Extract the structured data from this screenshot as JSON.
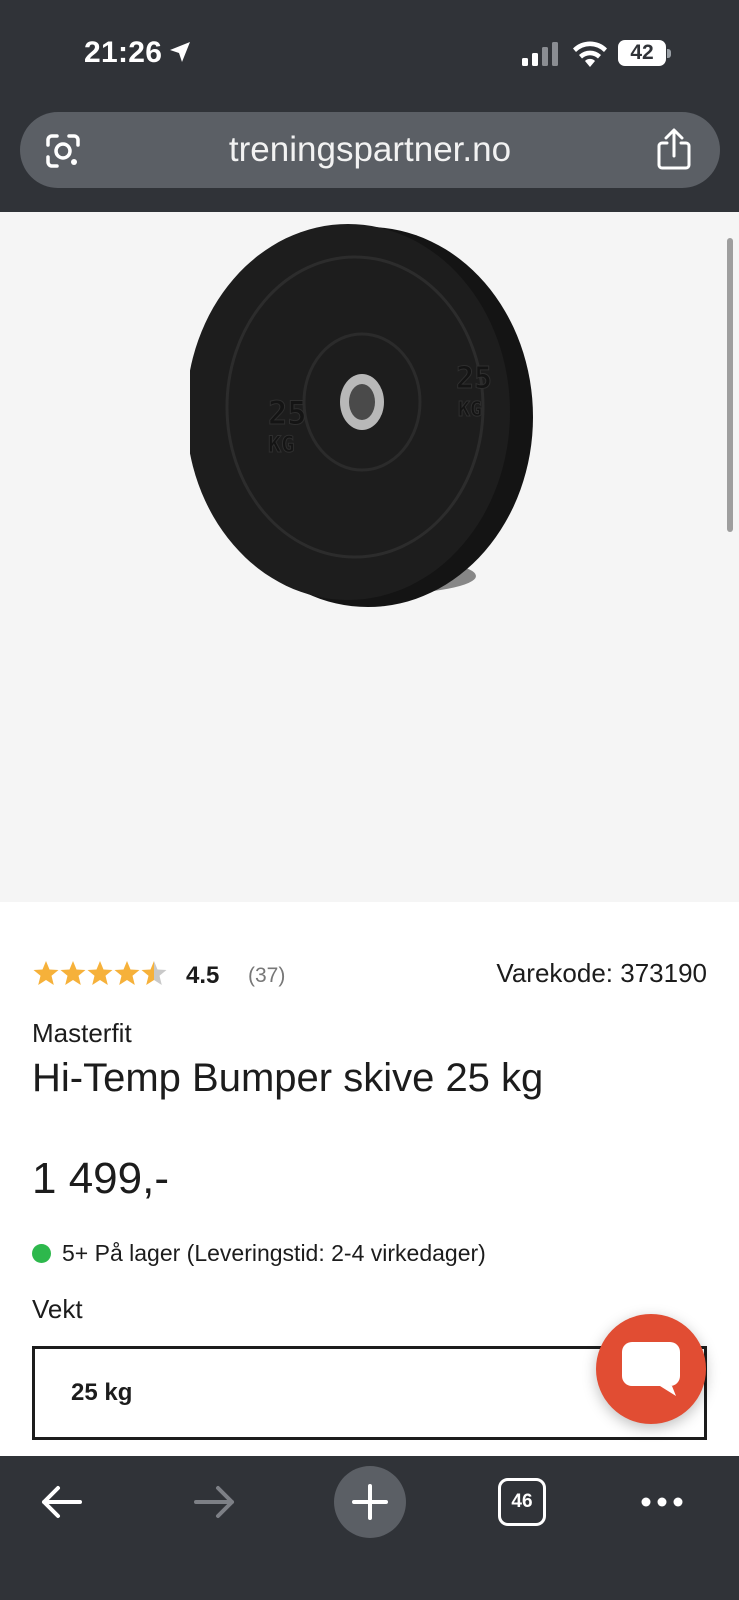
{
  "status_bar": {
    "time": "21:26",
    "battery": "42"
  },
  "browser": {
    "url": "treningspartner.no",
    "tab_count": "46"
  },
  "product": {
    "rating": {
      "value": "4.5",
      "count": "(37)",
      "stars": 4.5
    },
    "sku": "Varekode: 373190",
    "brand": "Masterfit",
    "title": "Hi-Temp Bumper skive 25 kg",
    "price": "1 499,-",
    "stock": "5+ På lager (Leveringstid: 2-4 virkedager)",
    "option_label": "Vekt",
    "option_value": "25 kg",
    "image": {
      "plate_label": "25",
      "plate_unit": "KG"
    }
  },
  "colors": {
    "chrome_bg": "#303338",
    "url_bar_bg": "#5b5f65",
    "star": "#f6b13a",
    "in_stock": "#2db84c",
    "chat_button": "#e14d33"
  },
  "icons": {
    "location": "location-arrow-icon",
    "signal": "signal-icon",
    "wifi": "wifi-icon",
    "lens": "google-lens-icon",
    "share": "share-icon",
    "chat": "chat-bubble-icon",
    "back": "arrow-left-icon",
    "forward": "arrow-right-icon",
    "new_tab": "plus-icon",
    "more": "more-dots-icon"
  }
}
